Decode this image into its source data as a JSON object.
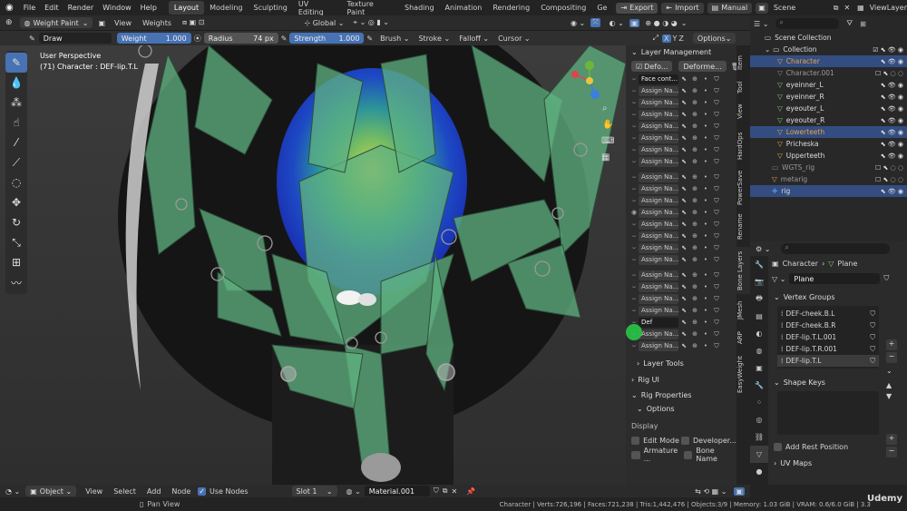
{
  "menubar": {
    "menus": [
      "File",
      "Edit",
      "Render",
      "Window",
      "Help"
    ],
    "workspaces": [
      "Layout",
      "Modeling",
      "Sculpting",
      "UV Editing",
      "Texture Paint",
      "Shading",
      "Animation",
      "Rendering",
      "Compositing",
      "Ge"
    ],
    "export_label": "Export",
    "import_label": "Import",
    "manual_label": "Manual",
    "scene_label": "Scene",
    "viewlayer_label": "ViewLayer"
  },
  "header": {
    "mode": "Weight Paint",
    "view": "View",
    "weights": "Weights",
    "transform": "Global",
    "options": "Options"
  },
  "toolsettings": {
    "brush": "Draw",
    "weight_label": "Weight",
    "weight_value": "1.000",
    "radius_label": "Radius",
    "radius_value": "74 px",
    "strength_label": "Strength",
    "strength_value": "1.000",
    "menus": [
      "Brush",
      "Stroke",
      "Falloff",
      "Cursor"
    ]
  },
  "viewport": {
    "perspective": "User Perspective",
    "object_info": "(71) Character : DEF-lip.T.L"
  },
  "npanel": {
    "title": "Layer Management",
    "btn1": "Defo...",
    "btn2": "Deforme...",
    "layers": [
      "Face cont...",
      "Assign Na...",
      "Assign Na...",
      "Assign Na...",
      "Assign Na...",
      "Assign Na...",
      "Assign Na...",
      "Assign Na...",
      "Assign Na...",
      "Assign Na...",
      "Assign Na...",
      "Assign Na...",
      "Assign Na...",
      "Assign Na...",
      "Assign Na...",
      "Assign Na...",
      "Assign Na...",
      "Assign Na...",
      "Assign Na...",
      "Assign Na...",
      "Def",
      "Assign Na...",
      "Assign Na..."
    ],
    "layer_tools": "Layer Tools",
    "rig_ui": "Rig UI",
    "rig_properties": "Rig Properties",
    "options": "Options",
    "display": "Display",
    "edit_mode": "Edit Mode",
    "developer": "Developer...",
    "armature": "Armature ...",
    "bone_name": "Bone Name"
  },
  "vtabs": [
    "Item",
    "Tool",
    "View",
    "HardOps",
    "PowerSave",
    "Rename",
    "Bone Layers",
    "JMesh",
    "ARP",
    "EasyWeight"
  ],
  "outliner": {
    "scene_collection": "Scene Collection",
    "collection": "Collection",
    "items": [
      "Character",
      "Character.001",
      "eyeinner_L",
      "eyeinner_R",
      "eyeouter_L",
      "eyeouter_R",
      "Lowerteeth",
      "Pricheska",
      "Upperteeth",
      "WGTS_rig",
      "metarig",
      "rig"
    ]
  },
  "properties": {
    "breadcrumb_object": "Character",
    "breadcrumb_mesh": "Plane",
    "mesh_name": "Plane",
    "vertex_groups_title": "Vertex Groups",
    "vertex_groups": [
      "DEF-cheek.B.L",
      "DEF-cheek.B.R",
      "DEF-lip.T.L.001",
      "DEF-lip.T.R.001",
      "DEF-lip.T.L"
    ],
    "shape_keys_title": "Shape Keys",
    "add_rest_position": "Add Rest Position",
    "uv_maps_title": "UV Maps"
  },
  "node_header": {
    "mode": "Object",
    "menus": [
      "View",
      "Select",
      "Add",
      "Node"
    ],
    "use_nodes": "Use Nodes",
    "slot": "Slot 1",
    "material": "Material.001"
  },
  "statusbar": {
    "hint": "Pan View",
    "stats": "Character | Verts:726,196 | Faces:721,238 | Tris:1,442,476 | Objects:3/9 | Memory: 1.03 GiB | VRAM: 0.6/6.0 GiB | 3.3",
    "watermark": "Udemy"
  },
  "colors": {
    "accent": "#4772b3",
    "bone_green": "#5fb381",
    "active_orange": "#e8a04a"
  }
}
